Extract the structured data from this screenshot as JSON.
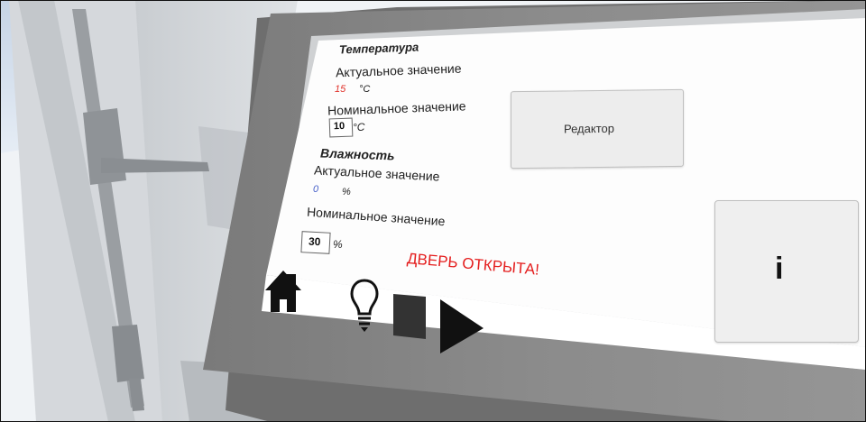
{
  "temperature": {
    "section_title": "Температура",
    "actual_label": "Актуальное значение",
    "actual_value": "15",
    "actual_unit": "°C",
    "nominal_label": "Номинальное значение",
    "nominal_value": "10",
    "nominal_unit": "°C"
  },
  "humidity": {
    "section_title": "Влажность",
    "actual_label": "Актуальное значение",
    "actual_value": "0",
    "actual_unit": "%",
    "nominal_label": "Номинальное значение",
    "nominal_value": "30",
    "nominal_unit": "%"
  },
  "editor_button_label": "Редактор",
  "info_button_label": "i",
  "door_status": "ДВЕРЬ ОТКРЫТА!",
  "colors": {
    "actual_temp": "#e0322b",
    "actual_humidity": "#4a63c9",
    "door_status": "#e41d1d"
  },
  "toolbar": {
    "icons": [
      "home-icon",
      "lightbulb-icon",
      "stop-icon",
      "play-icon"
    ]
  }
}
